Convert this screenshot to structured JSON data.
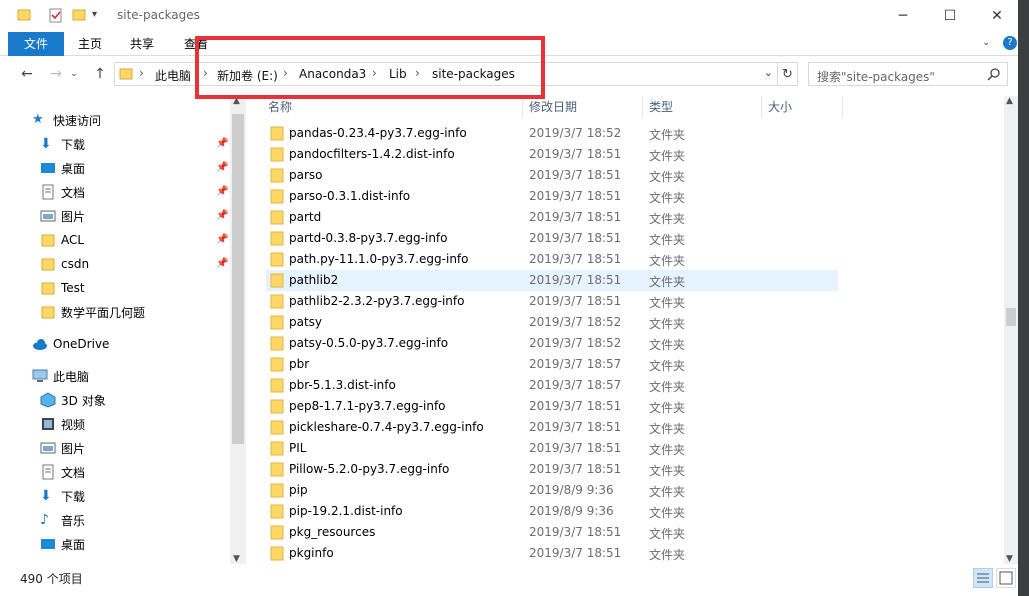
{
  "window": {
    "title": "site-packages",
    "minimize": "─",
    "maximize": "☐",
    "close": "✕"
  },
  "ribbon": {
    "tabs": [
      "文件",
      "主页",
      "共享",
      "查看"
    ],
    "help": "?"
  },
  "address": {
    "crumbs": [
      "此电脑",
      "新加卷 (E:)",
      "Anaconda3",
      "Lib",
      "site-packages"
    ],
    "search_placeholder": "搜索\"site-packages\""
  },
  "nav": {
    "quick_access": "快速访问",
    "quick_items": [
      "下载",
      "桌面",
      "文档",
      "图片",
      "ACL",
      "csdn",
      "Test",
      "数学平面几何题"
    ],
    "onedrive": "OneDrive",
    "this_pc": "此电脑",
    "pc_items": [
      "3D 对象",
      "视频",
      "图片",
      "文档",
      "下载",
      "音乐",
      "桌面"
    ]
  },
  "columns": {
    "name": "名称",
    "modified": "修改日期",
    "type": "类型",
    "size": "大小"
  },
  "files": [
    {
      "name": "pandas-0.23.4-py3.7.egg-info",
      "date": "2019/3/7 18:52",
      "type": "文件夹"
    },
    {
      "name": "pandocfilters-1.4.2.dist-info",
      "date": "2019/3/7 18:51",
      "type": "文件夹"
    },
    {
      "name": "parso",
      "date": "2019/3/7 18:51",
      "type": "文件夹"
    },
    {
      "name": "parso-0.3.1.dist-info",
      "date": "2019/3/7 18:51",
      "type": "文件夹"
    },
    {
      "name": "partd",
      "date": "2019/3/7 18:51",
      "type": "文件夹"
    },
    {
      "name": "partd-0.3.8-py3.7.egg-info",
      "date": "2019/3/7 18:51",
      "type": "文件夹"
    },
    {
      "name": "path.py-11.1.0-py3.7.egg-info",
      "date": "2019/3/7 18:51",
      "type": "文件夹"
    },
    {
      "name": "pathlib2",
      "date": "2019/3/7 18:51",
      "type": "文件夹"
    },
    {
      "name": "pathlib2-2.3.2-py3.7.egg-info",
      "date": "2019/3/7 18:51",
      "type": "文件夹"
    },
    {
      "name": "patsy",
      "date": "2019/3/7 18:52",
      "type": "文件夹"
    },
    {
      "name": "patsy-0.5.0-py3.7.egg-info",
      "date": "2019/3/7 18:52",
      "type": "文件夹"
    },
    {
      "name": "pbr",
      "date": "2019/3/7 18:57",
      "type": "文件夹"
    },
    {
      "name": "pbr-5.1.3.dist-info",
      "date": "2019/3/7 18:57",
      "type": "文件夹"
    },
    {
      "name": "pep8-1.7.1-py3.7.egg-info",
      "date": "2019/3/7 18:51",
      "type": "文件夹"
    },
    {
      "name": "pickleshare-0.7.4-py3.7.egg-info",
      "date": "2019/3/7 18:51",
      "type": "文件夹"
    },
    {
      "name": "PIL",
      "date": "2019/3/7 18:51",
      "type": "文件夹"
    },
    {
      "name": "Pillow-5.2.0-py3.7.egg-info",
      "date": "2019/3/7 18:51",
      "type": "文件夹"
    },
    {
      "name": "pip",
      "date": "2019/8/9 9:36",
      "type": "文件夹"
    },
    {
      "name": "pip-19.2.1.dist-info",
      "date": "2019/8/9 9:36",
      "type": "文件夹"
    },
    {
      "name": "pkg_resources",
      "date": "2019/3/7 18:51",
      "type": "文件夹"
    },
    {
      "name": "pkginfo",
      "date": "2019/3/7 18:51",
      "type": "文件夹"
    }
  ],
  "selected_row": 7,
  "status": {
    "count": "490 个项目"
  },
  "colors": {
    "accent": "#1979ca",
    "folder": "#ffd766",
    "highlight": "#e8323a",
    "selection": "#e5f3ff"
  }
}
